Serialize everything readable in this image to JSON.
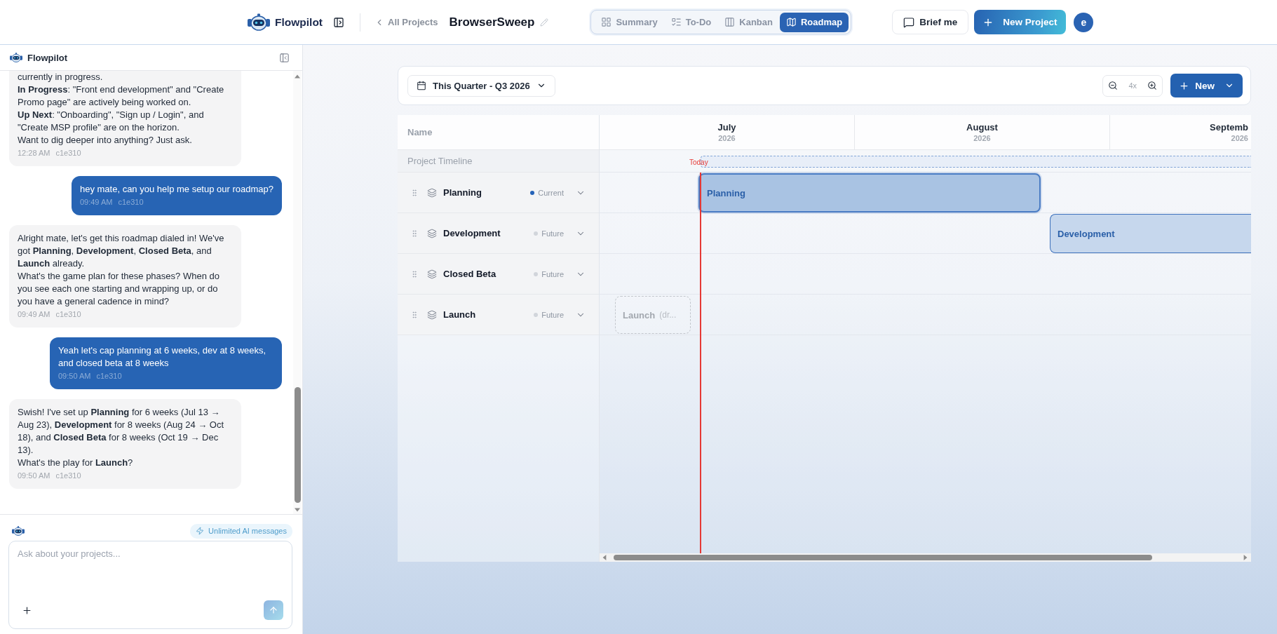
{
  "topbar": {
    "brand": "Flowpilot",
    "back_link": "All Projects",
    "project_title": "BrowserSweep",
    "tabs": [
      {
        "label": "Summary",
        "selected": false
      },
      {
        "label": "To-Do",
        "selected": false
      },
      {
        "label": "Kanban",
        "selected": false
      },
      {
        "label": "Roadmap",
        "selected": true
      }
    ],
    "brief_button": "Brief me",
    "new_project_button": "New Project",
    "avatar_initial": "e"
  },
  "chat": {
    "title": "Flowpilot",
    "messages": [
      {
        "kind": "assistant",
        "paragraphs": [
          "currently in progress.",
          "**In Progress**: \"Front end development\" and \"Create Promo page\" are actively being worked on.",
          "**Up Next**: \"Onboarding\", \"Sign up / Login\", and \"Create MSP profile\" are on the horizon.",
          "Want to dig deeper into anything? Just ask."
        ],
        "time": "12:28 AM",
        "author": "c1e310"
      },
      {
        "kind": "user",
        "paragraphs": [
          "hey mate, can you help me setup our roadmap?"
        ],
        "time": "09:49 AM",
        "author": "c1e310"
      },
      {
        "kind": "assistant",
        "paragraphs": [
          "Alright mate, let's get this roadmap dialed in! We've got **Planning**, **Development**, **Closed Beta**, and **Launch** already.",
          "What's the game plan for these phases? When do you see each one starting and wrapping up, or do you have a general cadence in mind?"
        ],
        "time": "09:49 AM",
        "author": "c1e310"
      },
      {
        "kind": "user",
        "paragraphs": [
          "Yeah let's cap planning at 6 weeks, dev at 8 weeks, and closed beta at 8 weeks"
        ],
        "time": "09:50 AM",
        "author": "c1e310"
      },
      {
        "kind": "assistant",
        "paragraphs": [
          "Swish! I've set up **Planning** for 6 weeks (Jul 13 → Aug 23), **Development** for 8 weeks (Aug 24 → Oct 18), and **Closed Beta** for 8 weeks (Oct 19 → Dec 13).",
          "What's the play for **Launch**?"
        ],
        "time": "09:50 AM",
        "author": "c1e310"
      }
    ],
    "quota_badge": "Unlimited AI messages",
    "composer": {
      "placeholder": "Ask about your projects..."
    }
  },
  "roadmap": {
    "period_selector": "This Quarter - Q3 2026",
    "zoom_level": "4x",
    "new_button": "New",
    "name_column": "Name",
    "months": [
      {
        "name": "July",
        "year": "2026"
      },
      {
        "name": "August",
        "year": "2026"
      },
      {
        "name": "Septemb",
        "year": "2026"
      }
    ],
    "timeline_row": "Project Timeline",
    "today_label": "Today",
    "phases": [
      {
        "name": "Planning",
        "status": "Current",
        "color": "#2563b8",
        "bar": {
          "kind": "active",
          "label": "Planning"
        }
      },
      {
        "name": "Development",
        "status": "Future",
        "color": "#d1d5db",
        "bar": {
          "kind": "planned",
          "label": "Development"
        }
      },
      {
        "name": "Closed Beta",
        "status": "Future",
        "color": "#d1d5db"
      },
      {
        "name": "Launch",
        "status": "Future",
        "color": "#d1d5db",
        "bar": {
          "kind": "draft",
          "label": "Launch",
          "hint": "(dr..."
        }
      }
    ]
  }
}
